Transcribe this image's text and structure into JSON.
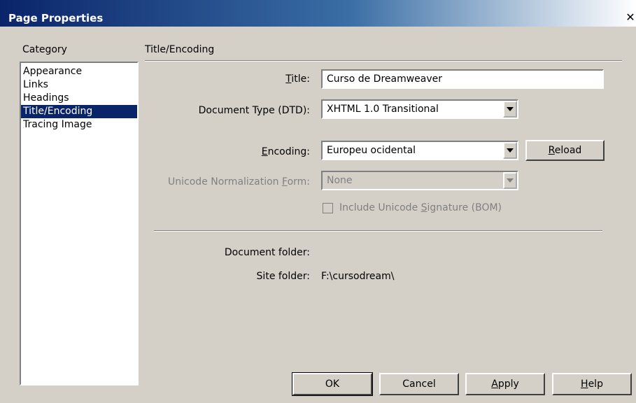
{
  "window": {
    "title": "Page Properties",
    "close_glyph": "✕"
  },
  "category": {
    "label": "Category",
    "items": [
      "Appearance",
      "Links",
      "Headings",
      "Title/Encoding",
      "Tracing Image"
    ],
    "selected": "Title/Encoding"
  },
  "section_title": "Title/Encoding",
  "form": {
    "title_label_pre": "",
    "title_label_u": "T",
    "title_label_post": "itle:",
    "title_value": "Curso de Dreamweaver",
    "doctype_label": "Document Type (DTD):",
    "doctype_value": "XHTML 1.0 Transitional",
    "encoding_label_pre": "",
    "encoding_label_u": "E",
    "encoding_label_post": "ncoding:",
    "encoding_value": "Europeu ocidental",
    "reload_pre": "",
    "reload_u": "R",
    "reload_post": "eload",
    "unicode_label_pre": "Unicode Normalization ",
    "unicode_label_u": "F",
    "unicode_label_post": "orm:",
    "unicode_value": "None",
    "bom_pre": "Include Unicode ",
    "bom_u": "S",
    "bom_post": "ignature (BOM)",
    "doc_folder_label": "Document folder:",
    "doc_folder_value": "",
    "site_folder_label": "Site folder:",
    "site_folder_value": "F:\\cursodream\\"
  },
  "buttons": {
    "ok": "OK",
    "cancel": "Cancel",
    "apply_pre": "",
    "apply_u": "A",
    "apply_post": "pply",
    "help_pre": "",
    "help_u": "H",
    "help_post": "elp"
  }
}
